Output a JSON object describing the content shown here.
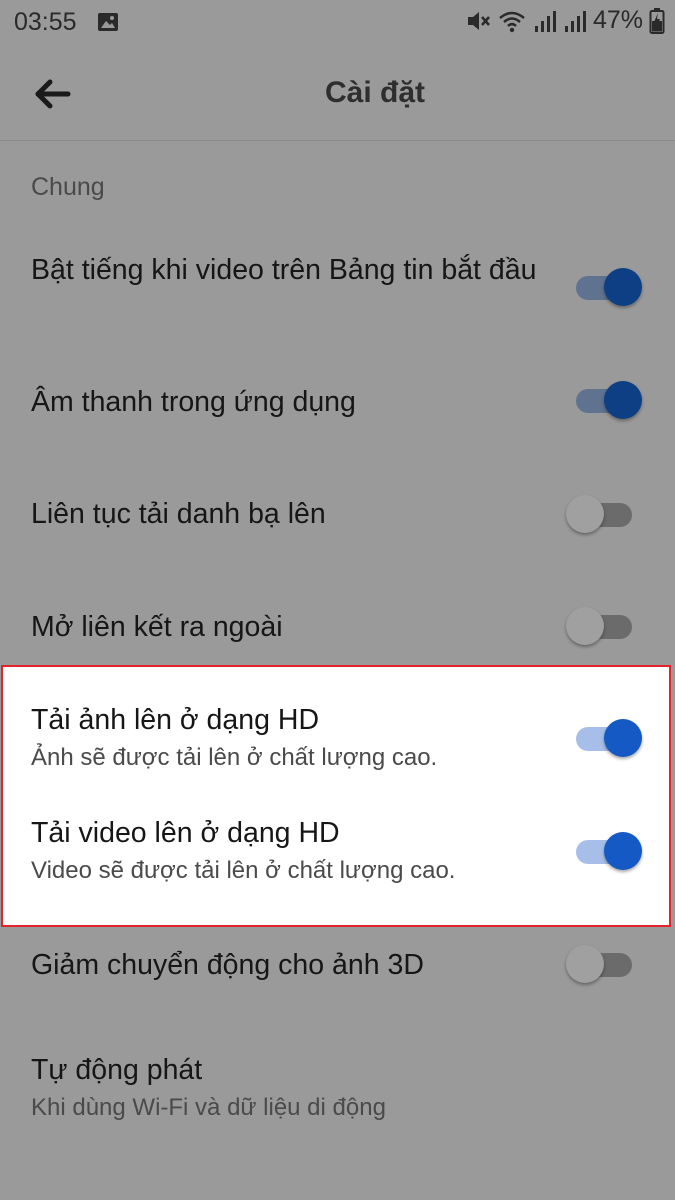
{
  "status_bar": {
    "time": "03:55",
    "battery": "47%",
    "icons": [
      "image-icon",
      "mute-icon",
      "wifi-icon",
      "signal-icon",
      "signal-icon",
      "battery-charging-icon"
    ]
  },
  "header": {
    "title": "Cài đặt",
    "back_icon": "back-arrow-icon"
  },
  "section": {
    "label": "Chung"
  },
  "settings": [
    {
      "title": "Bật tiếng khi video trên Bảng tin bắt đầu",
      "subtitle": "",
      "enabled": true
    },
    {
      "title": "Âm thanh trong ứng dụng",
      "subtitle": "",
      "enabled": true
    },
    {
      "title": "Liên tục tải danh bạ lên",
      "subtitle": "",
      "enabled": false
    },
    {
      "title": "Mở liên kết ra ngoài",
      "subtitle": "",
      "enabled": false
    },
    {
      "title": "Tải ảnh lên ở dạng HD",
      "subtitle": "Ảnh sẽ được tải lên ở chất lượng cao.",
      "enabled": true,
      "highlighted": true
    },
    {
      "title": "Tải video lên ở dạng HD",
      "subtitle": "Video sẽ được tải lên ở chất lượng cao.",
      "enabled": true,
      "highlighted": true
    },
    {
      "title": "Giảm chuyển động cho ảnh 3D",
      "subtitle": "",
      "enabled": false
    },
    {
      "title": "Tự động phát",
      "subtitle": "Khi dùng Wi-Fi và dữ liệu di động"
    }
  ],
  "colors": {
    "overlay_background": "#9a9a9a",
    "toggle_on": "#0e3f85",
    "toggle_on_highlighted": "#1459c4",
    "highlight_border": "#e2242a"
  }
}
